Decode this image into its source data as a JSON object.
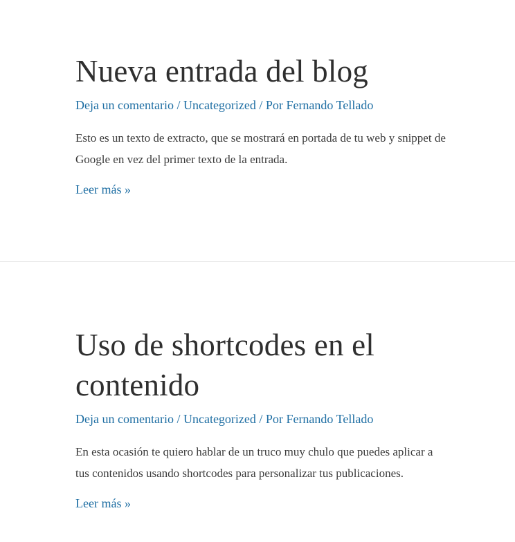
{
  "posts": [
    {
      "title": "Nueva entrada del blog",
      "meta": {
        "comments": "Deja un comentario",
        "separator1": " / ",
        "category": "Uncategorized",
        "separator2": " / Por ",
        "author": "Fernando Tellado"
      },
      "excerpt": "Esto es un texto de extracto, que se mostrará en portada de tu web y snippet de Google en vez del primer texto de la entrada.",
      "read_more": "Leer más »"
    },
    {
      "title": "Uso de shortcodes en el contenido",
      "meta": {
        "comments": "Deja un comentario",
        "separator1": " / ",
        "category": "Uncategorized",
        "separator2": " / Por ",
        "author": "Fernando Tellado"
      },
      "excerpt": "En esta ocasión te quiero hablar de un truco muy chulo que puedes aplicar a tus contenidos usando shortcodes para personalizar tus publicaciones.",
      "read_more": "Leer más »"
    }
  ],
  "colors": {
    "link": "#1e6ea3",
    "text": "#3a3a3a",
    "divider": "#e6e6e6"
  }
}
